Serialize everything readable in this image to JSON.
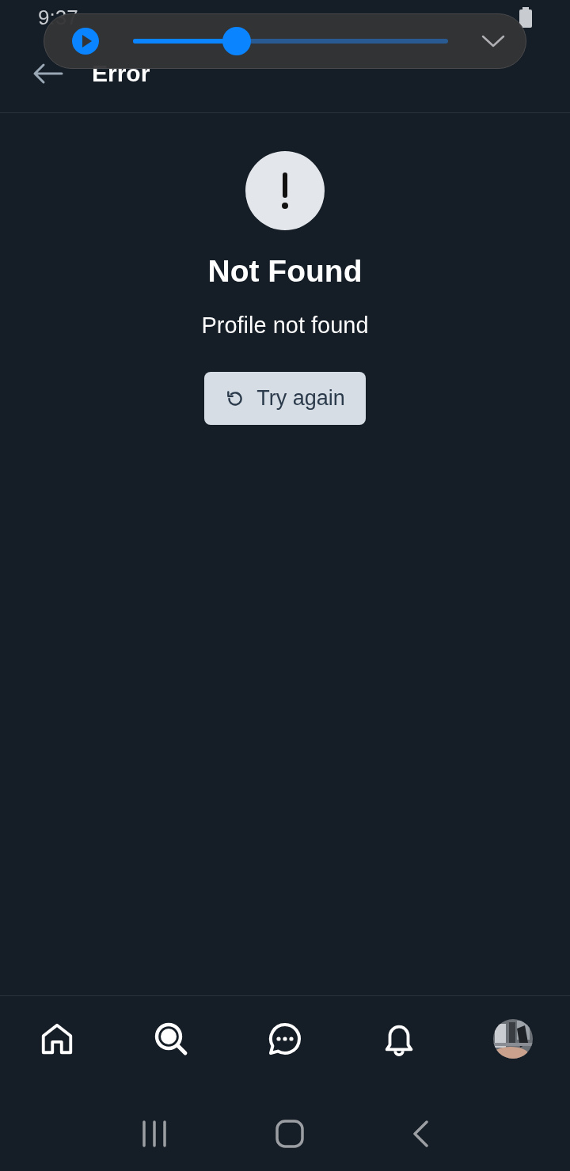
{
  "status_bar": {
    "time": "9:37"
  },
  "media_player": {
    "playing": false,
    "level": 0.33
  },
  "header": {
    "title": "Error"
  },
  "error": {
    "title": "Not Found",
    "message": "Profile not found",
    "button": "Try again"
  },
  "bottom_nav": [
    {
      "kind": "home"
    },
    {
      "kind": "search"
    },
    {
      "kind": "messages"
    },
    {
      "kind": "notifications"
    },
    {
      "kind": "profile"
    }
  ]
}
